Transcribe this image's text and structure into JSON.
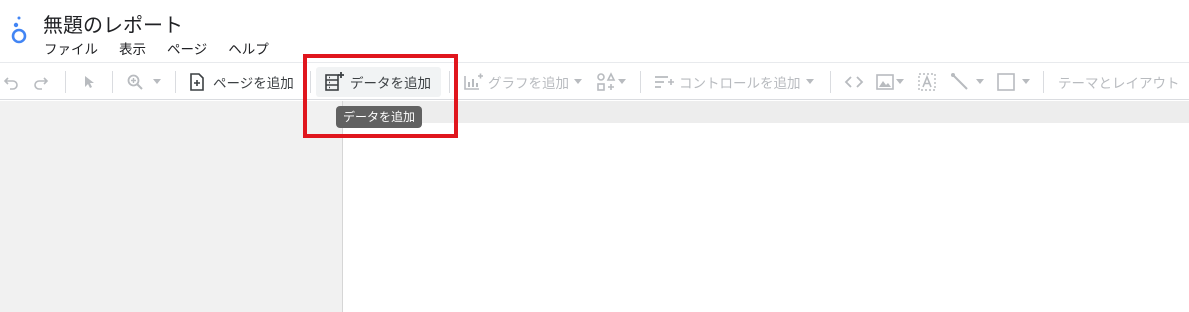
{
  "app": {
    "title": "無題のレポート",
    "logo_icon": "looker-studio-logo-icon"
  },
  "menu": [
    "ファイル",
    "表示",
    "ページ",
    "ヘルプ"
  ],
  "toolbar": {
    "undo_icon": "undo-icon",
    "redo_icon": "redo-icon",
    "select_icon": "pointer-icon",
    "zoom_icon": "zoom-icon",
    "add_page_label": "ページを追加",
    "add_data_label": "データを追加",
    "add_chart_label": "グラフを追加",
    "community_icon": "community-visualizations-icon",
    "add_control_label": "コントロールを追加",
    "embed_icon": "code-icon",
    "image_icon": "image-icon",
    "text_icon": "text-icon",
    "line_icon": "line-icon",
    "shape_icon": "rectangle-icon",
    "theme_label": "テーマとレイアウト"
  },
  "tooltip": "データを追加",
  "colors": {
    "highlight": "#e0161d",
    "tooltip_bg": "#616161",
    "logo_blue": "#4285f4"
  }
}
